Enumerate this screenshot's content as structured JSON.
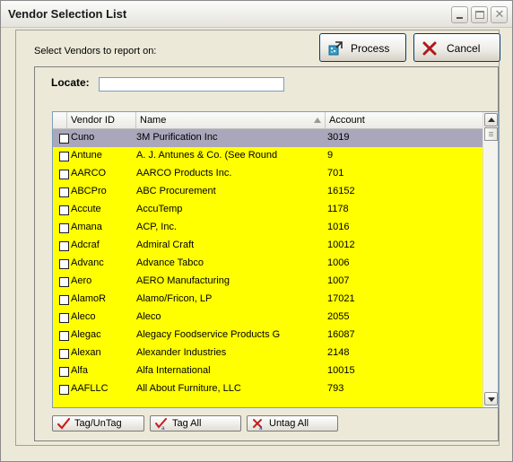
{
  "window": {
    "title": "Vendor Selection List"
  },
  "prompt": "Select Vendors to report on:",
  "buttons": {
    "process": "Process",
    "cancel": "Cancel",
    "tag_untag": "Tag/UnTag",
    "tag_all": "Tag All",
    "untag_all": "Untag All"
  },
  "locate": {
    "label": "Locate:",
    "value": ""
  },
  "grid": {
    "columns": [
      "Vendor ID",
      "Name",
      "Account"
    ],
    "sorted_column": "Name",
    "rows": [
      {
        "vendor_id": "Cuno",
        "name": "3M Purification Inc",
        "account": "3019",
        "selected": true
      },
      {
        "vendor_id": "Antune",
        "name": "A. J. Antunes & Co. (See Round",
        "account": "9"
      },
      {
        "vendor_id": "AARCO",
        "name": "AARCO Products Inc.",
        "account": "701"
      },
      {
        "vendor_id": "ABCPro",
        "name": "ABC Procurement",
        "account": "16152"
      },
      {
        "vendor_id": "Accute",
        "name": "AccuTemp",
        "account": "1178"
      },
      {
        "vendor_id": "Amana",
        "name": "ACP, Inc.",
        "account": "1016"
      },
      {
        "vendor_id": "Adcraf",
        "name": "Admiral Craft",
        "account": "10012"
      },
      {
        "vendor_id": "Advanc",
        "name": "Advance Tabco",
        "account": "1006"
      },
      {
        "vendor_id": "Aero",
        "name": "AERO Manufacturing",
        "account": "1007"
      },
      {
        "vendor_id": "AlamoR",
        "name": "Alamo/Fricon, LP",
        "account": "17021"
      },
      {
        "vendor_id": "Aleco",
        "name": "Aleco",
        "account": "2055"
      },
      {
        "vendor_id": "Alegac",
        "name": "Alegacy Foodservice Products G",
        "account": "16087"
      },
      {
        "vendor_id": "Alexan",
        "name": "Alexander Industries",
        "account": "2148"
      },
      {
        "vendor_id": "Alfa",
        "name": "Alfa International",
        "account": "10015"
      },
      {
        "vendor_id": "AAFLLC",
        "name": "All About Furniture, LLC",
        "account": "793"
      }
    ]
  },
  "colors": {
    "row_background": "#ffff00",
    "selected_row": "#aaa6bb",
    "window_bg": "#ece9d8"
  }
}
